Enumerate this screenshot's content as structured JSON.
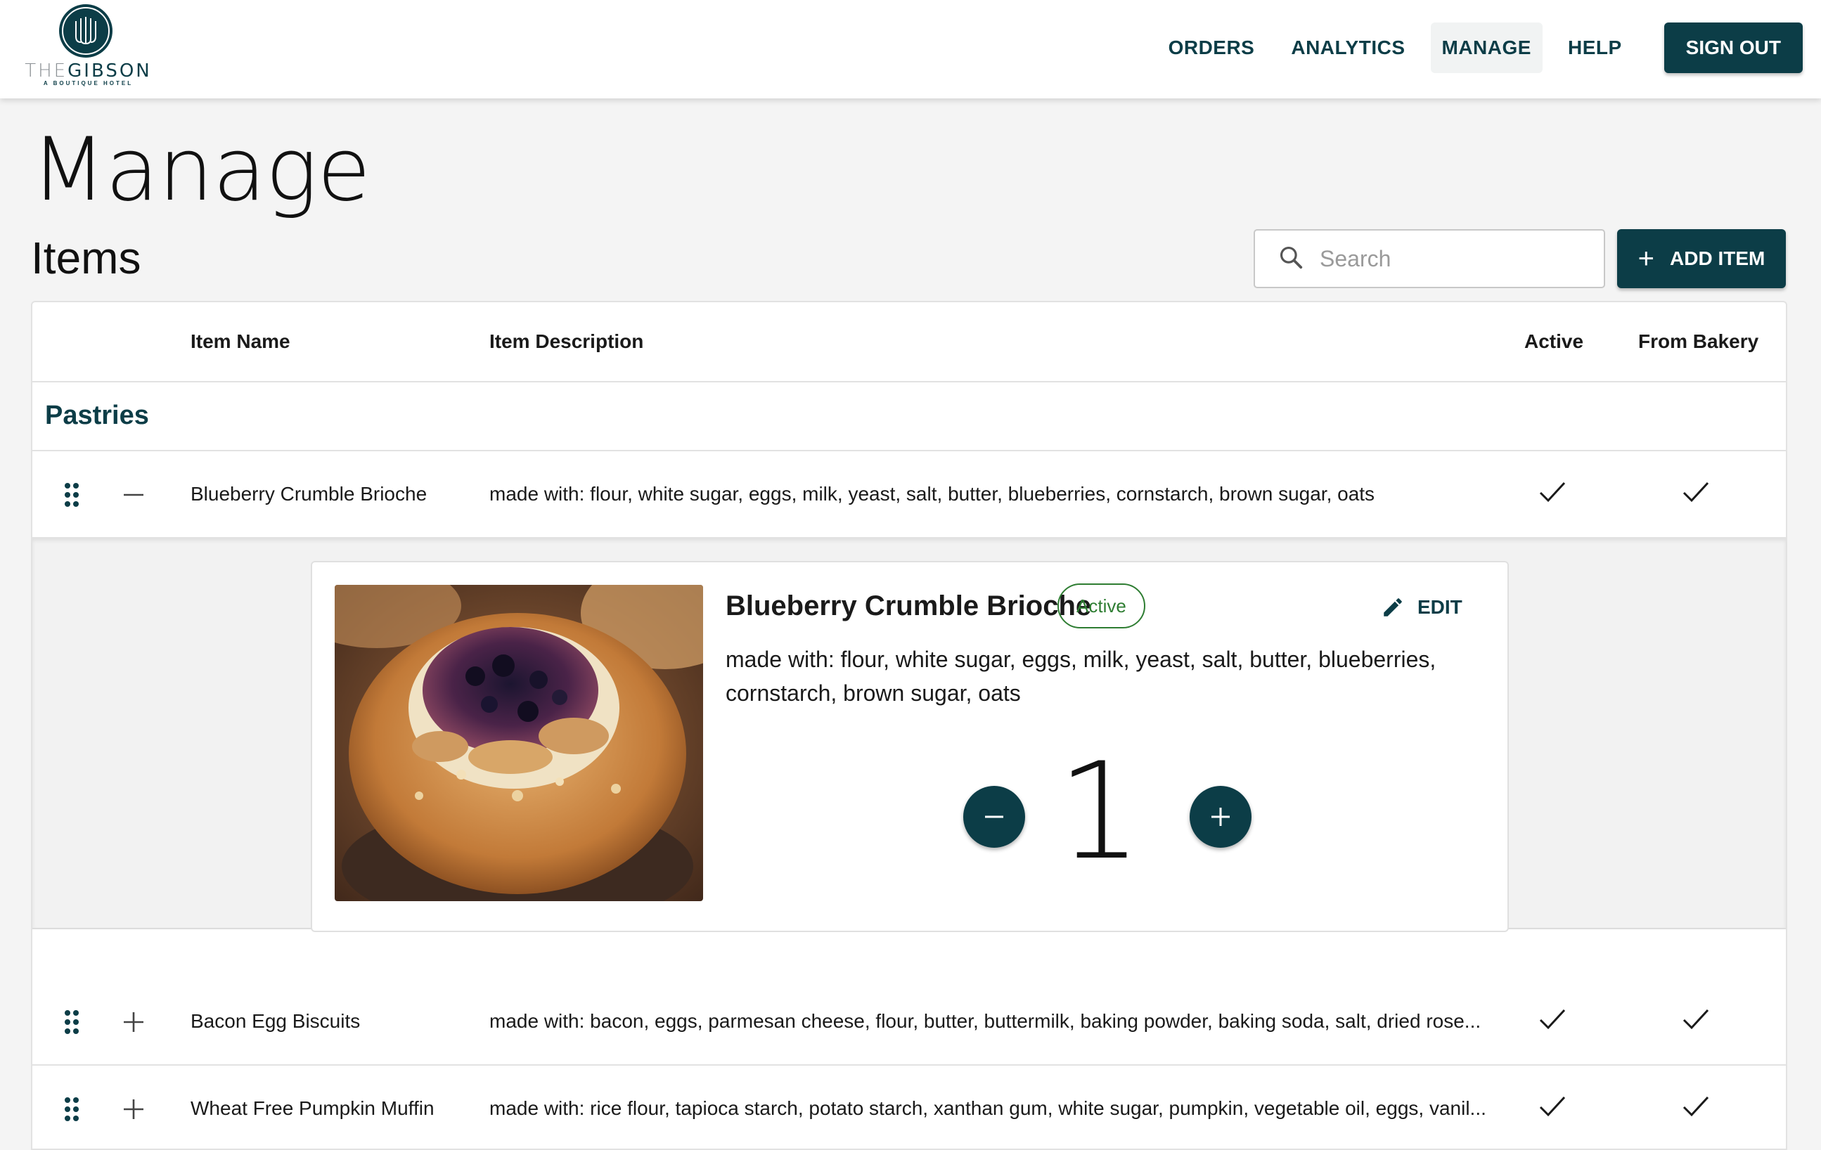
{
  "app": {
    "logo_name_light": "THE",
    "logo_name_bold": "GIBSON",
    "logo_tagline": "A BOUTIQUE HOTEL"
  },
  "nav": {
    "items": [
      {
        "label": "ORDERS",
        "active": false
      },
      {
        "label": "ANALYTICS",
        "active": false
      },
      {
        "label": "MANAGE",
        "active": true
      },
      {
        "label": "HELP",
        "active": false
      }
    ],
    "signout_label": "SIGN OUT"
  },
  "page": {
    "title": "Manage",
    "section_title": "Items"
  },
  "search": {
    "placeholder": "Search",
    "value": ""
  },
  "toolbar": {
    "add_item_label": "ADD ITEM"
  },
  "table": {
    "columns": {
      "name": "Item Name",
      "description": "Item Description",
      "active": "Active",
      "from_bakery": "From Bakery"
    },
    "category": "Pastries",
    "rows": [
      {
        "name": "Blueberry Crumble Brioche",
        "description": "made with: flour, white sugar, eggs, milk, yeast, salt, butter, blueberries, cornstarch, brown sugar, oats",
        "active": true,
        "from_bakery": true,
        "expanded": true
      },
      {
        "name": "Bacon Egg Biscuits",
        "description": "made with: bacon, eggs, parmesan cheese, flour, butter, buttermilk, baking powder, baking soda, salt, dried rose...",
        "active": true,
        "from_bakery": true,
        "expanded": false
      },
      {
        "name": "Wheat Free Pumpkin Muffin",
        "description": "made with: rice flour, tapioca starch, potato starch, xanthan gum, white sugar, pumpkin, vegetable oil, eggs, vanil...",
        "active": true,
        "from_bakery": true,
        "expanded": false
      }
    ]
  },
  "detail": {
    "title": "Blueberry Crumble Brioche",
    "status_badge": "Active",
    "edit_label": "EDIT",
    "description": "made with: flour, white sugar, eggs, milk, yeast, salt, butter, blueberries, cornstarch, brown sugar, oats",
    "quantity": "1"
  },
  "colors": {
    "brand": "#0c3d47",
    "active_badge": "#2e7d32",
    "background": "#f4f4f4"
  },
  "icons": {
    "search": "search-icon",
    "add": "plus-icon",
    "drag": "drag-handle-icon",
    "collapse": "minus-icon",
    "expand": "plus-icon",
    "check": "check-icon",
    "edit": "pencil-icon",
    "decrement": "minus-icon",
    "increment": "plus-icon"
  }
}
